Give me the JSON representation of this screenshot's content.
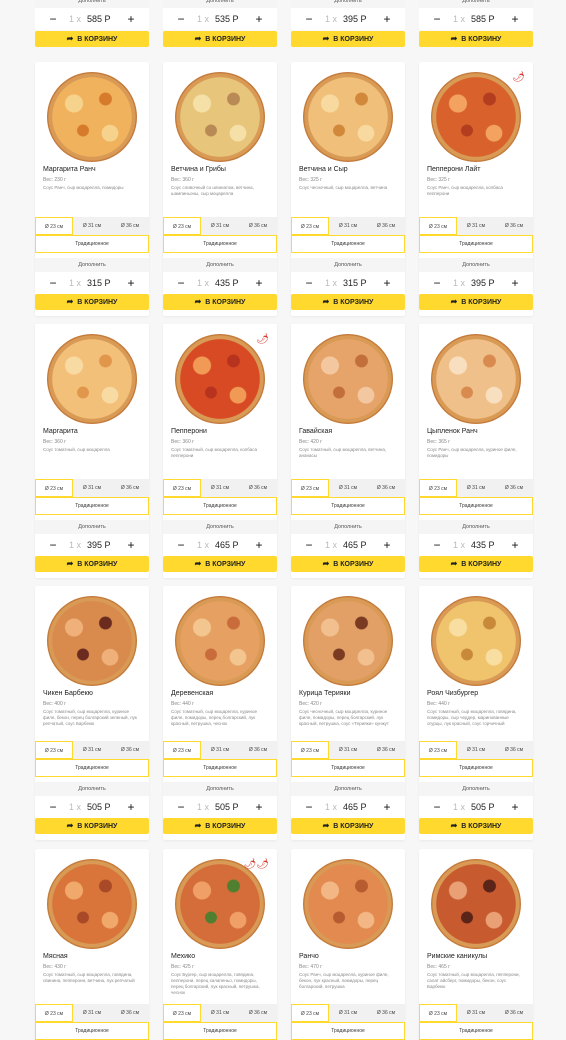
{
  "ui": {
    "add_more": "Дополнить",
    "in_cart": "В КОРЗИНУ",
    "sizes": [
      "Ø 23 см",
      "Ø 31 см",
      "Ø 36 см"
    ],
    "dough": "Традиционное",
    "qty_count": "1 x",
    "minus": "−",
    "plus": "+"
  },
  "top_prices": [
    "585 Р",
    "535 Р",
    "395 Р",
    "585 Р"
  ],
  "cards": [
    {
      "title": "Маргарита Ранч",
      "weight": "Вес: 230 г",
      "desc": "Соус Ранч, сыр моцарелла, помидоры",
      "price": "315 Р",
      "chili": "",
      "colors": [
        "#f1b25d",
        "#d67b2c",
        "#f6d38d"
      ]
    },
    {
      "title": "Ветчина и Грибы",
      "weight": "Вес: 360 г",
      "desc": "Соус сливочный со шпинатом, ветчина, шампиньоны, сыр моцарелла",
      "price": "435 Р",
      "chili": "",
      "colors": [
        "#e7c67b",
        "#b98a55",
        "#f5e0a8"
      ]
    },
    {
      "title": "Ветчина и Сыр",
      "weight": "Вес: 325 г",
      "desc": "Соус чесночный, сыр моцарелла, ветчина",
      "price": "315 Р",
      "chili": "",
      "colors": [
        "#f0c07a",
        "#d1883a",
        "#f8d99f"
      ]
    },
    {
      "title": "Пепперони Лайт",
      "weight": "Вес: 325 г",
      "desc": "Соус Ранч, сыр моцарелла, колбаса пепперони",
      "price": "395 Р",
      "chili": "🌶",
      "colors": [
        "#d9622c",
        "#b23d1f",
        "#f3a35f"
      ]
    },
    {
      "title": "Маргарита",
      "weight": "Вес: 360 г",
      "desc": "Соус томатный, сыр моцарелла",
      "price": "395 Р",
      "chili": "",
      "colors": [
        "#f3c07a",
        "#e1974b",
        "#f8daa3"
      ]
    },
    {
      "title": "Пепперони",
      "weight": "Вес: 360 г",
      "desc": "Соус томатный, сыр моцарелла, колбаса пепперони",
      "price": "465 Р",
      "chili": "🌶",
      "colors": [
        "#d84a24",
        "#b7331d",
        "#f19a56"
      ]
    },
    {
      "title": "Гавайская",
      "weight": "Вес: 420 г",
      "desc": "Соус томатный, сыр моцарелла, ветчина, ананасы",
      "price": "465 Р",
      "chili": "",
      "colors": [
        "#e6a46a",
        "#c36f3c",
        "#f3c8a0"
      ]
    },
    {
      "title": "Цыпленок Ранч",
      "weight": "Вес: 365 г",
      "desc": "Соус Ранч, сыр моцарелла, куриное филе, помидоры",
      "price": "435 Р",
      "chili": "",
      "colors": [
        "#f0c08a",
        "#d98b4f",
        "#f8dfc0"
      ]
    },
    {
      "title": "Чикен Барбекю",
      "weight": "Вес: 400 г",
      "desc": "Соус томатный, сыр моцарелла, куриное филе, бекон, перец болгарский зеленый, лук репчатый, соус Барбекю",
      "price": "505 Р",
      "chili": "",
      "colors": [
        "#d98a4d",
        "#6b2c1f",
        "#f0b07a"
      ]
    },
    {
      "title": "Деревенская",
      "weight": "Вес: 440 г",
      "desc": "Соус томатный, сыр моцарелла, куриное филе, помидоры, перец болгарский, лук красный, петрушка, чеснок",
      "price": "505 Р",
      "chili": "",
      "colors": [
        "#e6a062",
        "#c86c3b",
        "#f3c58f"
      ]
    },
    {
      "title": "Курица Терияки",
      "weight": "Вес: 420 г",
      "desc": "Соус чесночный, сыр моцарелла, куриное филе, помидоры, перец болгарский, лук красный, петрушка, соус «Терияки» кунжут",
      "price": "465 Р",
      "chili": "",
      "colors": [
        "#e2a066",
        "#7a3b22",
        "#f2c08f"
      ]
    },
    {
      "title": "Роял Чизбургер",
      "weight": "Вес: 440 г",
      "desc": "Соус томатный, сыр моцарелла, говядина, помидоры, сыр чеддер, маринованные огурцы, лук красный, соус горчичный",
      "price": "505 Р",
      "chili": "",
      "colors": [
        "#f0c46c",
        "#c88a3a",
        "#f8dea1"
      ]
    },
    {
      "title": "Мясная",
      "weight": "Вес: 430 г",
      "desc": "Соус томатный, сыр моцарелла, говядина, свинина, пепперони, ветчина, лук репчатый",
      "price": "",
      "chili": "",
      "colors": [
        "#d9743a",
        "#a84a27",
        "#f1a86b"
      ]
    },
    {
      "title": "Мехико",
      "weight": "Вес: 425 г",
      "desc": "Соус Бургер, сыр моцарелла, говядина, пепперони, перец халапеньо, помидоры, перец болгарский, лук красный, петрушка, чеснок",
      "price": "",
      "chili": "🌶🌶",
      "colors": [
        "#d46d39",
        "#4f7f2f",
        "#f0a066"
      ]
    },
    {
      "title": "Ранчо",
      "weight": "Вес: 470 г",
      "desc": "Соус Ранч, сыр моцарелла, куриное филе, бекон, лук красный, помидоры, перец болгарский, петрушка",
      "price": "",
      "chili": "",
      "colors": [
        "#e28a4f",
        "#b75b30",
        "#f2b785"
      ]
    },
    {
      "title": "Римские каникулы",
      "weight": "Вес: 465 г",
      "desc": "Соус томатный, сыр моцарелла, пепперони, салат айсберг, помидоры, бекон, соус Барбекю",
      "price": "",
      "chili": "",
      "colors": [
        "#c85a2f",
        "#5a2418",
        "#e9a075"
      ]
    }
  ]
}
